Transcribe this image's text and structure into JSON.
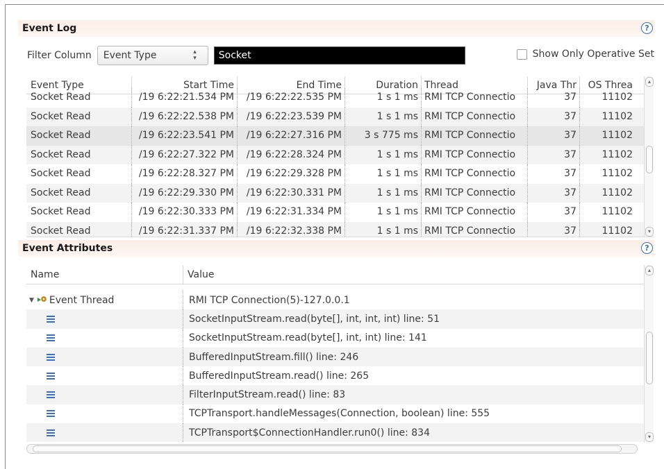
{
  "event_log": {
    "title": "Event Log",
    "help_icon": "help-icon",
    "filter": {
      "label": "Filter Column",
      "column_value": "Event Type",
      "input_value": "Socket",
      "checkbox_label": "Show Only Operative Set"
    },
    "columns": [
      "Event Type",
      "Start Time",
      "End Time",
      "Duration",
      "Thread",
      "Java Thr",
      "OS Threa"
    ],
    "rows": [
      [
        "Socket Read",
        "/19 6:22:21.534 PM",
        "/19 6:22:22.535 PM",
        "1 s 1 ms",
        "RMI TCP Connectio",
        "37",
        "11102"
      ],
      [
        "Socket Read",
        "/19 6:22:22.538 PM",
        "/19 6:22:23.539 PM",
        "1 s 1 ms",
        "RMI TCP Connectio",
        "37",
        "11102"
      ],
      [
        "Socket Read",
        "/19 6:22:23.541 PM",
        "/19 6:22:27.316 PM",
        "3 s 775 ms",
        "RMI TCP Connectio",
        "37",
        "11102"
      ],
      [
        "Socket Read",
        "/19 6:22:27.322 PM",
        "/19 6:22:28.324 PM",
        "1 s 1 ms",
        "RMI TCP Connectio",
        "37",
        "11102"
      ],
      [
        "Socket Read",
        "/19 6:22:28.327 PM",
        "/19 6:22:29.328 PM",
        "1 s 1 ms",
        "RMI TCP Connectio",
        "37",
        "11102"
      ],
      [
        "Socket Read",
        "/19 6:22:29.330 PM",
        "/19 6:22:30.331 PM",
        "1 s 1 ms",
        "RMI TCP Connectio",
        "37",
        "11102"
      ],
      [
        "Socket Read",
        "/19 6:22:30.333 PM",
        "/19 6:22:31.334 PM",
        "1 s 1 ms",
        "RMI TCP Connectio",
        "37",
        "11102"
      ],
      [
        "Socket Read",
        "/19 6:22:31.337 PM",
        "/19 6:22:32.338 PM",
        "1 s 1 ms",
        "RMI TCP Connectio",
        "37",
        "11102"
      ]
    ],
    "selected_row": 2
  },
  "event_attributes": {
    "title": "Event Attributes",
    "help_icon": "help-icon",
    "columns": [
      "Name",
      "Value"
    ],
    "thread_row": {
      "name": "Event Thread",
      "value": "RMI TCP Connection(5)-127.0.0.1",
      "icon": "thread-icon"
    },
    "stack_rows": [
      "SocketInputStream.read(byte[], int, int, int) line: 51",
      "SocketInputStream.read(byte[], int, int) line: 141",
      "BufferedInputStream.fill() line: 246",
      "BufferedInputStream.read() line: 265",
      "FilterInputStream.read() line: 83",
      "TCPTransport.handleMessages(Connection, boolean) line: 555",
      "TCPTransport$ConnectionHandler.run0() line: 834"
    ],
    "stack_icon": "stack-frame-icon"
  },
  "colors": {
    "header_gradient": "#fbeee6",
    "filter_input_bg": "#000000",
    "selected_row": "#e6e6e6",
    "icon_blue": "#3a6fc0"
  }
}
